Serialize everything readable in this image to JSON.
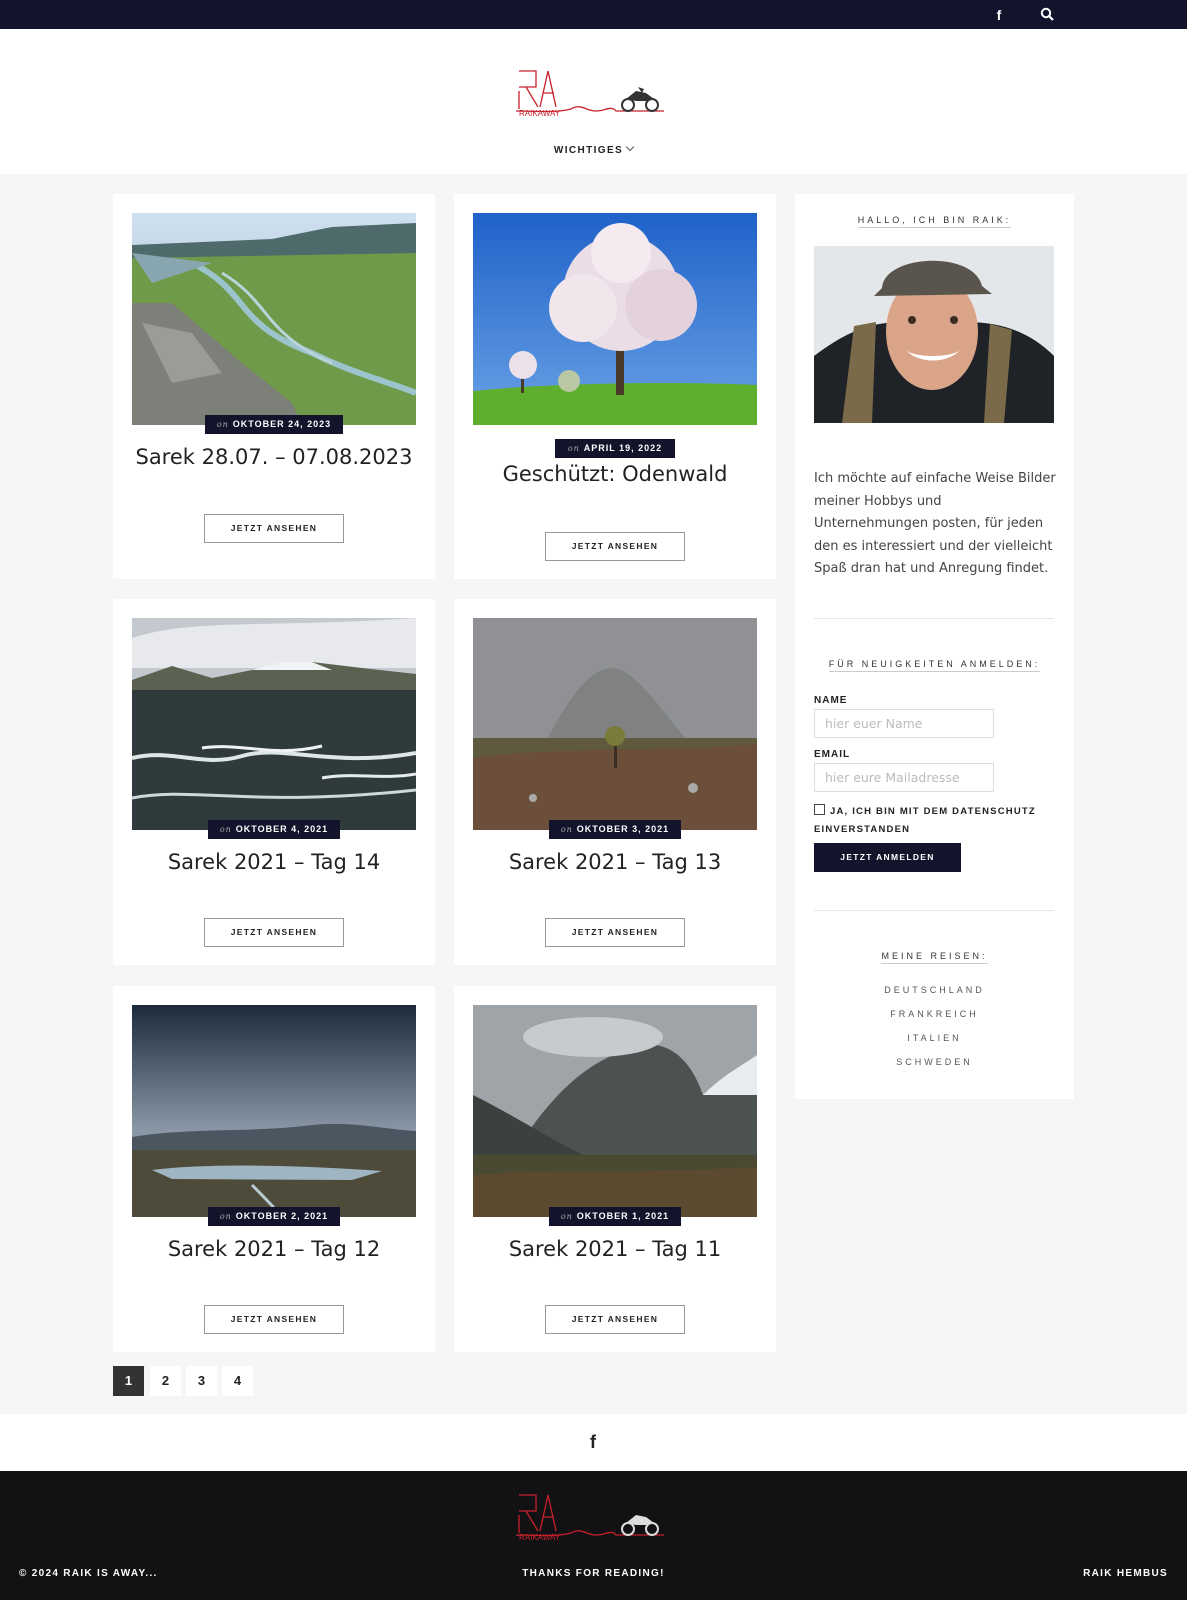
{
  "topbar": {
    "icons": [
      "facebook-icon",
      "search-icon"
    ],
    "facebook_glyph": "f"
  },
  "header": {
    "nav_label": "WICHTIGES"
  },
  "posts": [
    {
      "date_prefix": "on",
      "date": "OKTOBER 24, 2023",
      "title": "Sarek 28.07. – 07.08.2023",
      "button": "JETZT ANSEHEN"
    },
    {
      "date_prefix": "on",
      "date": "APRIL 19, 2022",
      "title": "Geschützt: Odenwald",
      "button": "JETZT ANSEHEN"
    },
    {
      "date_prefix": "on",
      "date": "OKTOBER 4, 2021",
      "title": "Sarek 2021 – Tag 14",
      "button": "JETZT ANSEHEN"
    },
    {
      "date_prefix": "on",
      "date": "OKTOBER 3, 2021",
      "title": "Sarek 2021 – Tag 13",
      "button": "JETZT ANSEHEN"
    },
    {
      "date_prefix": "on",
      "date": "OKTOBER 2, 2021",
      "title": "Sarek 2021 – Tag 12",
      "button": "JETZT ANSEHEN"
    },
    {
      "date_prefix": "on",
      "date": "OKTOBER 1, 2021",
      "title": "Sarek 2021 – Tag 11",
      "button": "JETZT ANSEHEN"
    }
  ],
  "pagination": [
    "1",
    "2",
    "3",
    "4"
  ],
  "sidebar": {
    "about_title": "HALLO, ICH BIN RAIK:",
    "about_text": "Ich möchte auf einfache Weise Bilder meiner Hobbys und Unternehmungen posten, für jeden den es interessiert und der vielleicht Spaß dran hat und Anregung findet.",
    "newsletter_title": "FÜR NEUIGKEITEN ANMELDEN:",
    "name_label": "NAME",
    "name_placeholder": "hier euer Name",
    "email_label": "EMAIL",
    "email_placeholder": "hier eure Mailadresse",
    "consent": "JA, ICH BIN MIT DEM DATENSCHUTZ EINVERSTANDEN",
    "subscribe": "JETZT ANMELDEN",
    "trips_title": "MEINE REISEN:",
    "trips": [
      "DEUTSCHLAND",
      "FRANKREICH",
      "ITALIEN",
      "SCHWEDEN"
    ]
  },
  "footer": {
    "copyright": "© 2024 RAIK IS AWAY...",
    "center": "THANKS FOR READING!",
    "right": "RAIK HEMBUS",
    "logo_text": "RAIKAWAY"
  },
  "colors": {
    "navy": "#13132b",
    "logo_red": "#c8202a",
    "footer_bg": "#121214"
  }
}
